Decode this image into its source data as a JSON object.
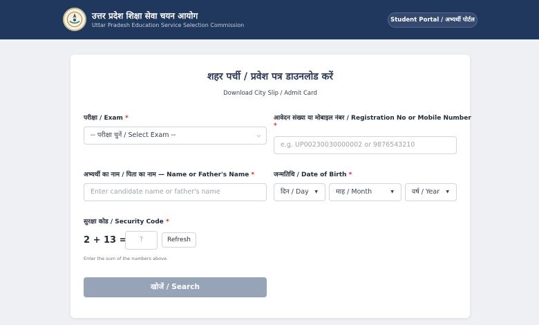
{
  "header": {
    "org_name_hi": "उत्तर प्रदेश शिक्षा सेवा चयन आयोग",
    "org_name_en": "Uttar Pradesh Education Service Selection Commission",
    "portal_label": "Student Portal / अभ्यर्थी पोर्टल"
  },
  "form": {
    "title_hi": "शहर पर्ची / प्रवेश पत्र डाउनलोड करें",
    "title_en": "Download City Slip / Admit Card",
    "exam": {
      "label": "परीक्षा / Exam",
      "selected": "-- परीक्षा चुनें / Select Exam --"
    },
    "registration": {
      "label_line1": "आवेदन संख्या या मोबाइल नंबर / Registration No or Mobile Number",
      "placeholder": "e.g. UP00230030000002 or 9876543210"
    },
    "candidate_name": {
      "label": "अभ्यर्थी का नाम / पिता का नाम — Name or Father's Name",
      "placeholder": "Enter candidate name or father's name"
    },
    "dob": {
      "label": "जन्मतिथि / Date of Birth",
      "day": "दिन / Day",
      "month": "माह / Month",
      "year": "वर्ष / Year"
    },
    "security": {
      "label": "सुरक्षा कोड / Security Code",
      "question": "2 + 13 =",
      "placeholder": "?",
      "refresh_label": "Refresh",
      "hint": "Enter the sum of the numbers above."
    },
    "required_mark": "*",
    "search_label": "खोजें / Search"
  },
  "colors": {
    "header_bg": "#21385e",
    "search_button_bg": "#97a4b8",
    "required": "#dc2626"
  }
}
